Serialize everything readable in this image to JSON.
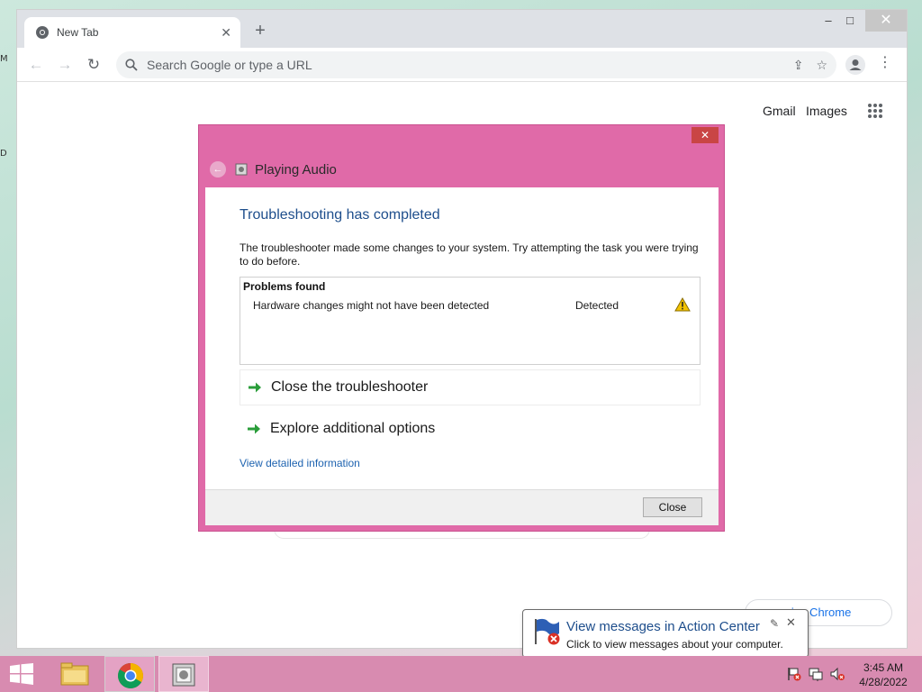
{
  "desktop": {
    "edge_glyph_1": "M",
    "edge_glyph_2": "D"
  },
  "browser": {
    "tab_title": "New Tab",
    "tab_close": "✕",
    "new_tab": "+",
    "window_minimize": "–",
    "window_maximize": "□",
    "window_close": "✕",
    "omnibox_placeholder": "Search Google or type a URL",
    "ntp_links": {
      "gmail": "Gmail",
      "images": "Images"
    },
    "customize_label": "mize Chrome"
  },
  "dialog": {
    "close": "✕",
    "title": "Playing Audio",
    "heading": "Troubleshooting has completed",
    "description": "The troubleshooter made some changes to your system. Try attempting the task you were trying to do before.",
    "problems_header": "Problems found",
    "problems": [
      {
        "name": "Hardware changes might not have been detected",
        "status": "Detected"
      }
    ],
    "options": [
      {
        "label": "Close the troubleshooter"
      },
      {
        "label": "Explore additional options"
      }
    ],
    "detail_link": "View detailed information",
    "close_button": "Close"
  },
  "notification": {
    "title": "View messages in Action Center",
    "text": "Click to view messages about your computer.",
    "close": "✕"
  },
  "taskbar": {
    "time": "3:45 AM",
    "date": "4/28/2022"
  },
  "colors": {
    "dialog_frame": "#e06aa8",
    "taskbar": "#d88bb0",
    "link_blue": "#1e4e8c",
    "chrome_accent": "#1a73e8"
  }
}
